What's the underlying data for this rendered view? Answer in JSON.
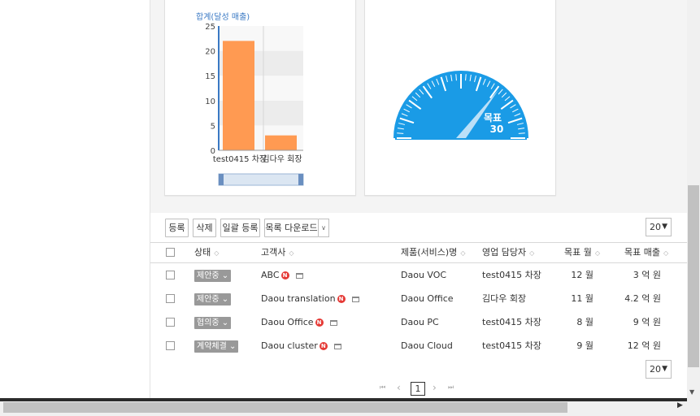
{
  "chart_data": {
    "type": "bar",
    "ylabel": "합계(달성 매출)",
    "categories": [
      "test0415 차장",
      "김다우 회장"
    ],
    "values": [
      22,
      3
    ],
    "ylim": [
      0,
      25
    ],
    "yticks": [
      "0",
      "5",
      "10",
      "15",
      "20",
      "25"
    ],
    "bar_color": "#ff9a52",
    "grid": true
  },
  "gauge": {
    "label": "목표",
    "value": "30",
    "color": "#1a9be6"
  },
  "toolbar": {
    "register": "등록",
    "delete": "삭제",
    "bulk_register": "일괄 등록",
    "download": "목록 다운로드",
    "download_caret": "∨",
    "page_size": "20",
    "page_size_arrow": "▼"
  },
  "table": {
    "headers": {
      "status": "상태",
      "customer": "고객사",
      "product": "제품(서비스)명",
      "manager": "영업 담당자",
      "target_month": "목표 월",
      "target_sales": "목표 매출"
    },
    "sort_glyph": "◇",
    "rows": [
      {
        "status": "제안중",
        "customer": "ABC",
        "new": "N",
        "product": "Daou VOC",
        "manager": "test0415 차장",
        "month": "12 월",
        "sales": "3 억 원"
      },
      {
        "status": "제안중",
        "customer": "Daou translation",
        "new": "N",
        "product": "Daou Office",
        "manager": "김다우 회장",
        "month": "11 월",
        "sales": "4.2 억 원"
      },
      {
        "status": "협의중",
        "customer": "Daou Office",
        "new": "N",
        "product": "Daou PC",
        "manager": "test0415 차장",
        "month": "8 월",
        "sales": "9 억 원"
      },
      {
        "status": "계약체결",
        "customer": "Daou cluster",
        "new": "N",
        "product": "Daou Cloud",
        "manager": "test0415 차장",
        "month": "9 월",
        "sales": "12 억 원"
      }
    ],
    "status_caret": "⌄"
  },
  "pager": {
    "first": "⏮",
    "prev": "‹",
    "current": "1",
    "next": "›",
    "last": "⏭",
    "page_size": "20",
    "page_size_arrow": "▼"
  },
  "scroll": {
    "down": "▼",
    "left": "◀",
    "right": "▶"
  }
}
